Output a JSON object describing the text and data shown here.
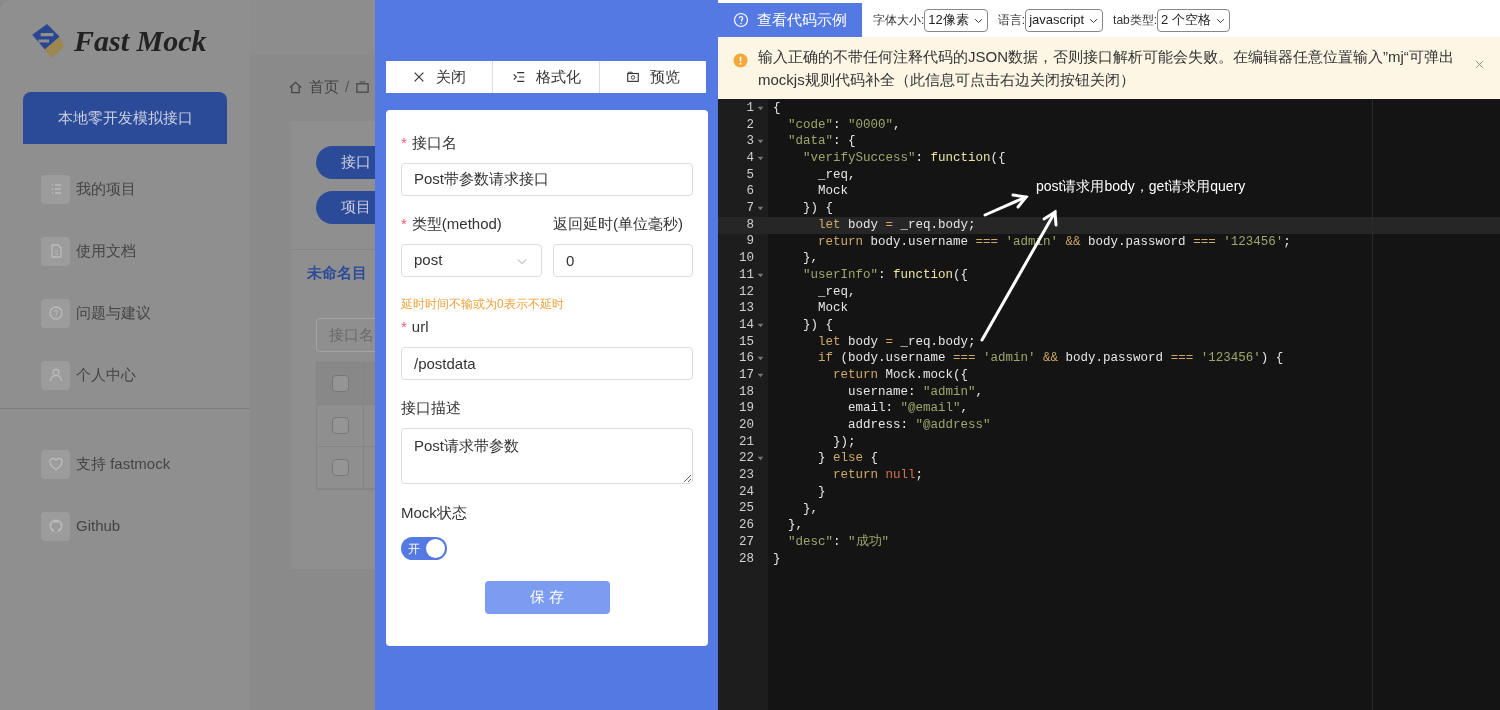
{
  "app": {
    "logo": "Fast Mock",
    "nav_primary": "本地零开发模拟接口",
    "nav_items": [
      {
        "label": "我的项目"
      },
      {
        "label": "使用文档"
      },
      {
        "label": "问题与建议"
      },
      {
        "label": "个人中心"
      }
    ],
    "footer_items": [
      {
        "label": "支持 fastmock"
      },
      {
        "label": "Github"
      }
    ],
    "breadcrumb": [
      "首页",
      "/"
    ],
    "buttons": [
      "接口",
      "项目"
    ],
    "directory": "未命名目",
    "search": {
      "placeholder": "接口名"
    },
    "table_rows": [
      {
        "checked": false
      },
      {
        "checked": false
      },
      {
        "checked": false
      }
    ]
  },
  "toolbar": [
    {
      "label": "关闭"
    },
    {
      "label": "格式化"
    },
    {
      "label": "预览"
    }
  ],
  "form": {
    "required_mark": "*",
    "name": {
      "label": "接口名",
      "required": true,
      "value": "Post带参数请求接口"
    },
    "method": {
      "label": "类型(method)",
      "required": true,
      "value": "post"
    },
    "delay": {
      "label": "返回延时(单位毫秒)",
      "required": false,
      "value": "0"
    },
    "hint": "延时时间不输或为0表示不延时",
    "url": {
      "label": "url",
      "required": true,
      "value": "/postdata"
    },
    "description": {
      "label": "接口描述",
      "required": false,
      "value": "Post请求带参数"
    },
    "mock_status": {
      "label": "Mock状态",
      "on": true,
      "on_text": "开"
    },
    "save": "保 存"
  },
  "editor": {
    "help_button": "查看代码示例",
    "settings": [
      {
        "label": "字体大小:",
        "value": "12像素"
      },
      {
        "label": "语言:",
        "value": "javascript"
      },
      {
        "label": "tab类型:",
        "value": "2 个空格"
      }
    ],
    "notice": "输入正确的不带任何注释代码的JSON数据，否则接口解析可能会失败。在编辑器任意位置输入”mj“可弹出mockjs规则代码补全（此信息可点击右边关闭按钮关闭）",
    "lines": [
      {
        "number": "1",
        "foldable": true,
        "active": false,
        "tokens": [
          {
            "kind": "plain",
            "text": "{"
          }
        ]
      },
      {
        "number": "2",
        "foldable": false,
        "active": false,
        "tokens": [
          {
            "kind": "string",
            "text": "  \"code\""
          },
          {
            "kind": "plain",
            "text": ": "
          },
          {
            "kind": "string",
            "text": "\"0000\""
          },
          {
            "kind": "plain",
            "text": ","
          }
        ]
      },
      {
        "number": "3",
        "foldable": true,
        "active": false,
        "tokens": [
          {
            "kind": "string",
            "text": "  \"data\""
          },
          {
            "kind": "plain",
            "text": ": {"
          }
        ]
      },
      {
        "number": "4",
        "foldable": true,
        "active": false,
        "tokens": [
          {
            "kind": "string",
            "text": "    \"verifySuccess\""
          },
          {
            "kind": "plain",
            "text": ": "
          },
          {
            "kind": "func",
            "text": "function"
          },
          {
            "kind": "plain",
            "text": "({"
          }
        ]
      },
      {
        "number": "5",
        "foldable": false,
        "active": false,
        "tokens": [
          {
            "kind": "plain",
            "text": "      _req,"
          }
        ]
      },
      {
        "number": "6",
        "foldable": false,
        "active": false,
        "tokens": [
          {
            "kind": "plain",
            "text": "      Mock"
          }
        ]
      },
      {
        "number": "7",
        "foldable": true,
        "active": false,
        "tokens": [
          {
            "kind": "plain",
            "text": "    }) {"
          }
        ]
      },
      {
        "number": "8",
        "foldable": false,
        "active": true,
        "tokens": [
          {
            "kind": "keyword",
            "text": "      let"
          },
          {
            "kind": "plain",
            "text": " body "
          },
          {
            "kind": "op",
            "text": "="
          },
          {
            "kind": "plain",
            "text": " _req.body;"
          }
        ]
      },
      {
        "number": "9",
        "foldable": false,
        "active": false,
        "tokens": [
          {
            "kind": "keyword",
            "text": "      return"
          },
          {
            "kind": "plain",
            "text": " body.username "
          },
          {
            "kind": "op",
            "text": "==="
          },
          {
            "kind": "string",
            "text": " 'admin'"
          },
          {
            "kind": "op",
            "text": " &&"
          },
          {
            "kind": "plain",
            "text": " body.password "
          },
          {
            "kind": "op",
            "text": "==="
          },
          {
            "kind": "string",
            "text": " '123456'"
          },
          {
            "kind": "plain",
            "text": ";"
          }
        ]
      },
      {
        "number": "10",
        "foldable": false,
        "active": false,
        "tokens": [
          {
            "kind": "plain",
            "text": "    },"
          }
        ]
      },
      {
        "number": "11",
        "foldable": true,
        "active": false,
        "tokens": [
          {
            "kind": "string",
            "text": "    \"userInfo\""
          },
          {
            "kind": "plain",
            "text": ": "
          },
          {
            "kind": "func",
            "text": "function"
          },
          {
            "kind": "plain",
            "text": "({"
          }
        ]
      },
      {
        "number": "12",
        "foldable": false,
        "active": false,
        "tokens": [
          {
            "kind": "plain",
            "text": "      _req,"
          }
        ]
      },
      {
        "number": "13",
        "foldable": false,
        "active": false,
        "tokens": [
          {
            "kind": "plain",
            "text": "      Mock"
          }
        ]
      },
      {
        "number": "14",
        "foldable": true,
        "active": false,
        "tokens": [
          {
            "kind": "plain",
            "text": "    }) {"
          }
        ]
      },
      {
        "number": "15",
        "foldable": false,
        "active": false,
        "tokens": [
          {
            "kind": "keyword",
            "text": "      let"
          },
          {
            "kind": "plain",
            "text": " body "
          },
          {
            "kind": "op",
            "text": "="
          },
          {
            "kind": "plain",
            "text": " _req.body;"
          }
        ]
      },
      {
        "number": "16",
        "foldable": true,
        "active": false,
        "tokens": [
          {
            "kind": "keyword",
            "text": "      if"
          },
          {
            "kind": "plain",
            "text": " (body.username "
          },
          {
            "kind": "op",
            "text": "==="
          },
          {
            "kind": "string",
            "text": " 'admin'"
          },
          {
            "kind": "op",
            "text": " &&"
          },
          {
            "kind": "plain",
            "text": " body.password "
          },
          {
            "kind": "op",
            "text": "==="
          },
          {
            "kind": "string",
            "text": " '123456'"
          },
          {
            "kind": "plain",
            "text": ") {"
          }
        ]
      },
      {
        "number": "17",
        "foldable": true,
        "active": false,
        "tokens": [
          {
            "kind": "keyword",
            "text": "        return"
          },
          {
            "kind": "plain",
            "text": " Mock.mock({"
          }
        ]
      },
      {
        "number": "18",
        "foldable": false,
        "active": false,
        "tokens": [
          {
            "kind": "plain",
            "text": "          username: "
          },
          {
            "kind": "string",
            "text": "\"admin\""
          },
          {
            "kind": "plain",
            "text": ","
          }
        ]
      },
      {
        "number": "19",
        "foldable": false,
        "active": false,
        "tokens": [
          {
            "kind": "plain",
            "text": "          email: "
          },
          {
            "kind": "string",
            "text": "\"@email\""
          },
          {
            "kind": "plain",
            "text": ","
          }
        ]
      },
      {
        "number": "20",
        "foldable": false,
        "active": false,
        "tokens": [
          {
            "kind": "plain",
            "text": "          address: "
          },
          {
            "kind": "string",
            "text": "\"@address\""
          }
        ]
      },
      {
        "number": "21",
        "foldable": false,
        "active": false,
        "tokens": [
          {
            "kind": "plain",
            "text": "        });"
          }
        ]
      },
      {
        "number": "22",
        "foldable": true,
        "active": false,
        "tokens": [
          {
            "kind": "plain",
            "text": "      } "
          },
          {
            "kind": "keyword",
            "text": "else"
          },
          {
            "kind": "plain",
            "text": " {"
          }
        ]
      },
      {
        "number": "23",
        "foldable": false,
        "active": false,
        "tokens": [
          {
            "kind": "keyword",
            "text": "        return"
          },
          {
            "kind": "const",
            "text": " null"
          },
          {
            "kind": "plain",
            "text": ";"
          }
        ]
      },
      {
        "number": "24",
        "foldable": false,
        "active": false,
        "tokens": [
          {
            "kind": "plain",
            "text": "      }"
          }
        ]
      },
      {
        "number": "25",
        "foldable": false,
        "active": false,
        "tokens": [
          {
            "kind": "plain",
            "text": "    },"
          }
        ]
      },
      {
        "number": "26",
        "foldable": false,
        "active": false,
        "tokens": [
          {
            "kind": "plain",
            "text": "  },"
          }
        ]
      },
      {
        "number": "27",
        "foldable": false,
        "active": false,
        "tokens": [
          {
            "kind": "string",
            "text": "  \"desc\""
          },
          {
            "kind": "plain",
            "text": ": "
          },
          {
            "kind": "string",
            "text": "\"成功\""
          }
        ]
      },
      {
        "number": "28",
        "foldable": false,
        "active": false,
        "tokens": [
          {
            "kind": "plain",
            "text": "}"
          }
        ]
      }
    ],
    "annotation": "post请求用body，get请求用query"
  }
}
